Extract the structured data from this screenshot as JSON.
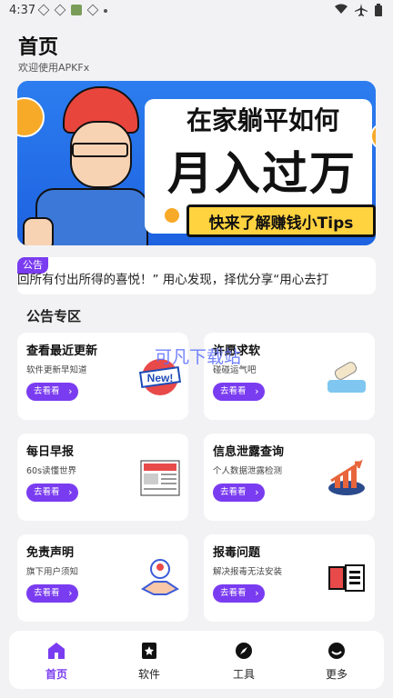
{
  "status_bar": {
    "time": "4:37"
  },
  "header": {
    "title": "首页",
    "subtitle": "欢迎使用APKFx"
  },
  "banner": {
    "line1": "在家躺平如何",
    "line2": "月入过万",
    "pill": "快来了解赚钱小Tips"
  },
  "notice": {
    "badge": "公告",
    "text": "回所有付出所得的喜悦！” 用心发现，择优分享“用心去打"
  },
  "section": {
    "title": "公告专区"
  },
  "cards": [
    {
      "title": "查看最近更新",
      "desc": "软件更新早知道",
      "button": "去看看"
    },
    {
      "title": "许愿求软",
      "desc": "碰碰运气吧",
      "button": "去看看"
    },
    {
      "title": "每日早报",
      "desc": "60s读懂世界",
      "button": "去看看"
    },
    {
      "title": "信息泄露查询",
      "desc": "个人数据泄露检测",
      "button": "去看看"
    },
    {
      "title": "免责声明",
      "desc": "旗下用户须知",
      "button": "去看看"
    },
    {
      "title": "报毒问题",
      "desc": "解决报毒无法安装",
      "button": "去看看"
    }
  ],
  "watermark": "可凡下载站",
  "tabbar": [
    {
      "label": "首页",
      "icon": "home-icon"
    },
    {
      "label": "软件",
      "icon": "bookmark-icon"
    },
    {
      "label": "工具",
      "icon": "compass-icon"
    },
    {
      "label": "更多",
      "icon": "smile-icon"
    }
  ],
  "colors": {
    "accent": "#7a3cf0",
    "background": "#f2f2f4",
    "banner_blue": "#1f6fe8",
    "pill_yellow": "#ffd23f"
  }
}
